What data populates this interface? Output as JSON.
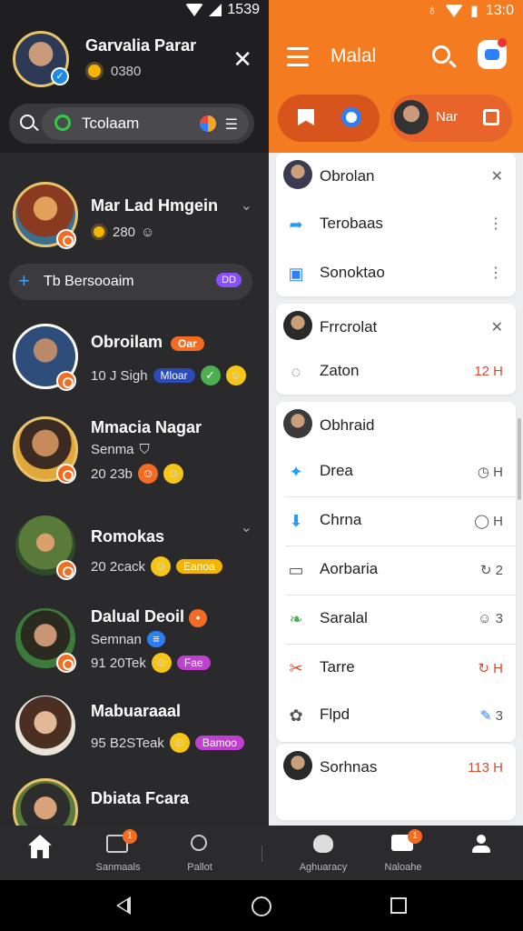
{
  "status_left": {
    "time": "1539"
  },
  "status_right": {
    "time": "13:0"
  },
  "profile": {
    "name": "Garvalia Parar",
    "sub": "0380"
  },
  "left_search": {
    "text": "Tcolaam"
  },
  "promo": {
    "text": "Tb Bersooaim",
    "tag": "DD"
  },
  "chats": [
    {
      "name": "Mar Lad Hmgein",
      "meta": "280"
    },
    {
      "name": "Obroilam",
      "tag": "Oar",
      "meta": "10 J Sigh",
      "pill": "Mloar"
    },
    {
      "name": "Mmacia Nagar",
      "meta_top": "Senma",
      "meta": "20 23b"
    },
    {
      "name": "Romokas",
      "meta": "20 2cack",
      "pill": "Eanoa"
    },
    {
      "name": "Dalual Deoil",
      "meta_top": "Semnan",
      "meta": "91 20Tek",
      "pill": "Fae"
    },
    {
      "name": "Mabuaraaal",
      "meta": "95 B2STeak",
      "pill": "Bamoo"
    },
    {
      "name": "Dbiata Fcara"
    }
  ],
  "right_header": {
    "title": "Malal"
  },
  "right_tabs": {
    "second_label": "Nar"
  },
  "right_cards": [
    {
      "items": [
        {
          "label": "Obrolan"
        },
        {
          "label": "Terobaas"
        },
        {
          "label": "Sonoktao"
        }
      ]
    },
    {
      "items": [
        {
          "label": "Frrcrolat"
        },
        {
          "label": "Zaton",
          "time": "12 H"
        }
      ]
    },
    {
      "items": [
        {
          "label": "Obhraid"
        },
        {
          "label": "Drea",
          "time": "H"
        },
        {
          "label": "Chrna",
          "time": "H"
        },
        {
          "label": "Aorbaria",
          "time": "2"
        },
        {
          "label": "Saralal",
          "time": "3"
        },
        {
          "label": "Tarre",
          "time": "H"
        },
        {
          "label": "Flpd",
          "time": "3"
        }
      ]
    },
    {
      "items": [
        {
          "label": "Sorhnas",
          "time": "113 H"
        }
      ]
    }
  ],
  "bottom_nav": [
    {
      "label": ""
    },
    {
      "label": "Sanmaals"
    },
    {
      "label": "Pallot"
    },
    {
      "label": "Aghuaracy"
    },
    {
      "label": "Naloahe"
    },
    {
      "label": ""
    }
  ]
}
